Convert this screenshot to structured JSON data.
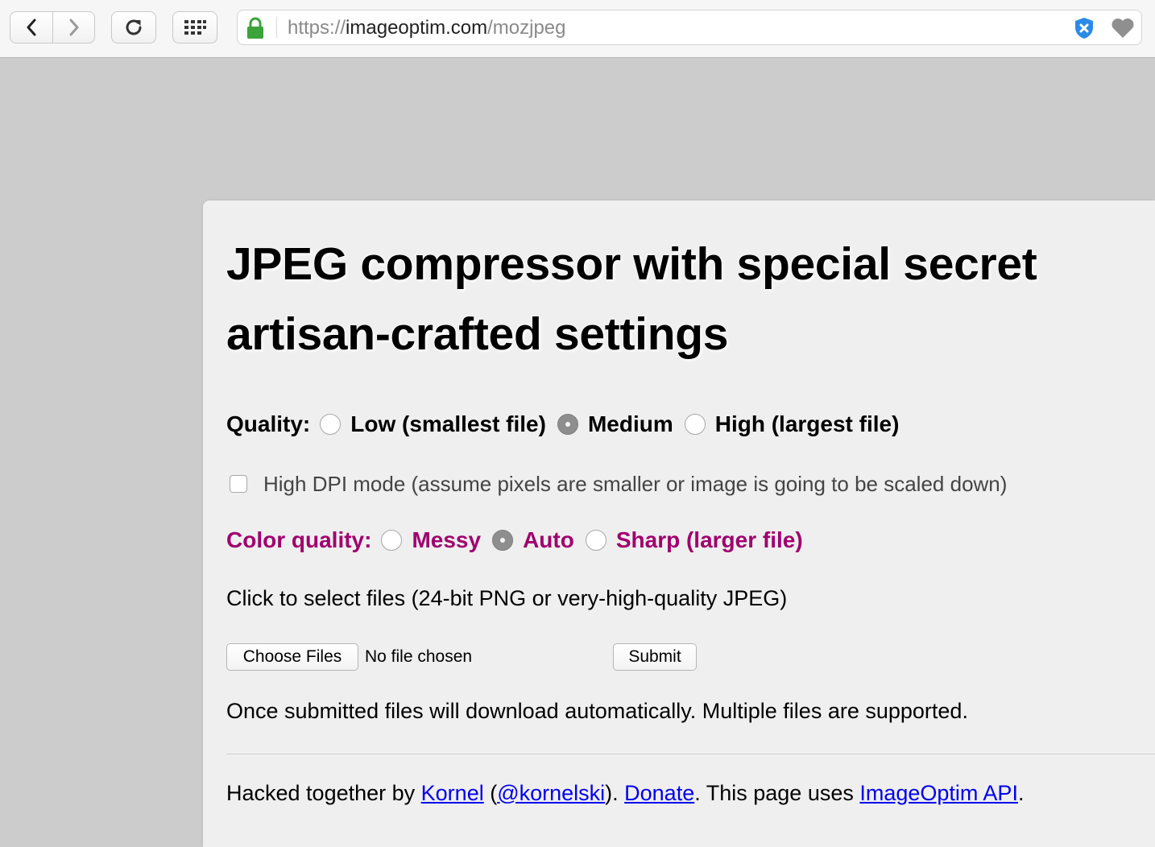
{
  "browser": {
    "url_scheme": "https://",
    "url_host": "imageoptim.com",
    "url_path": "/mozjpeg"
  },
  "page": {
    "title": "JPEG compressor with special secret artisan-crafted settings",
    "quality": {
      "label": "Quality:",
      "options": [
        {
          "label": "Low (smallest file)",
          "checked": false
        },
        {
          "label": "Medium",
          "checked": true
        },
        {
          "label": "High (largest file)",
          "checked": false
        }
      ]
    },
    "high_dpi": {
      "label": "High DPI mode (assume pixels are smaller or image is going to be scaled down)",
      "checked": false
    },
    "color_quality": {
      "label": "Color quality:",
      "color": "#a0006e",
      "options": [
        {
          "label": "Messy",
          "checked": false
        },
        {
          "label": "Auto",
          "checked": true
        },
        {
          "label": "Sharp (larger file)",
          "checked": false
        }
      ]
    },
    "select_instructions": "Click to select files (24-bit PNG or very-high-quality JPEG)",
    "choose_files_label": "Choose Files",
    "no_file_text": "No file chosen",
    "submit_label": "Submit",
    "note": "Once submitted files will download automatically. Multiple files are supported.",
    "footer": {
      "prefix": "Hacked together by ",
      "author_link": "Kornel",
      "paren_open": " (",
      "twitter_link": "@kornelski",
      "paren_close": "). ",
      "donate_link": "Donate",
      "middle": ". This page uses ",
      "api_link": "ImageOptim API",
      "suffix": "."
    }
  }
}
